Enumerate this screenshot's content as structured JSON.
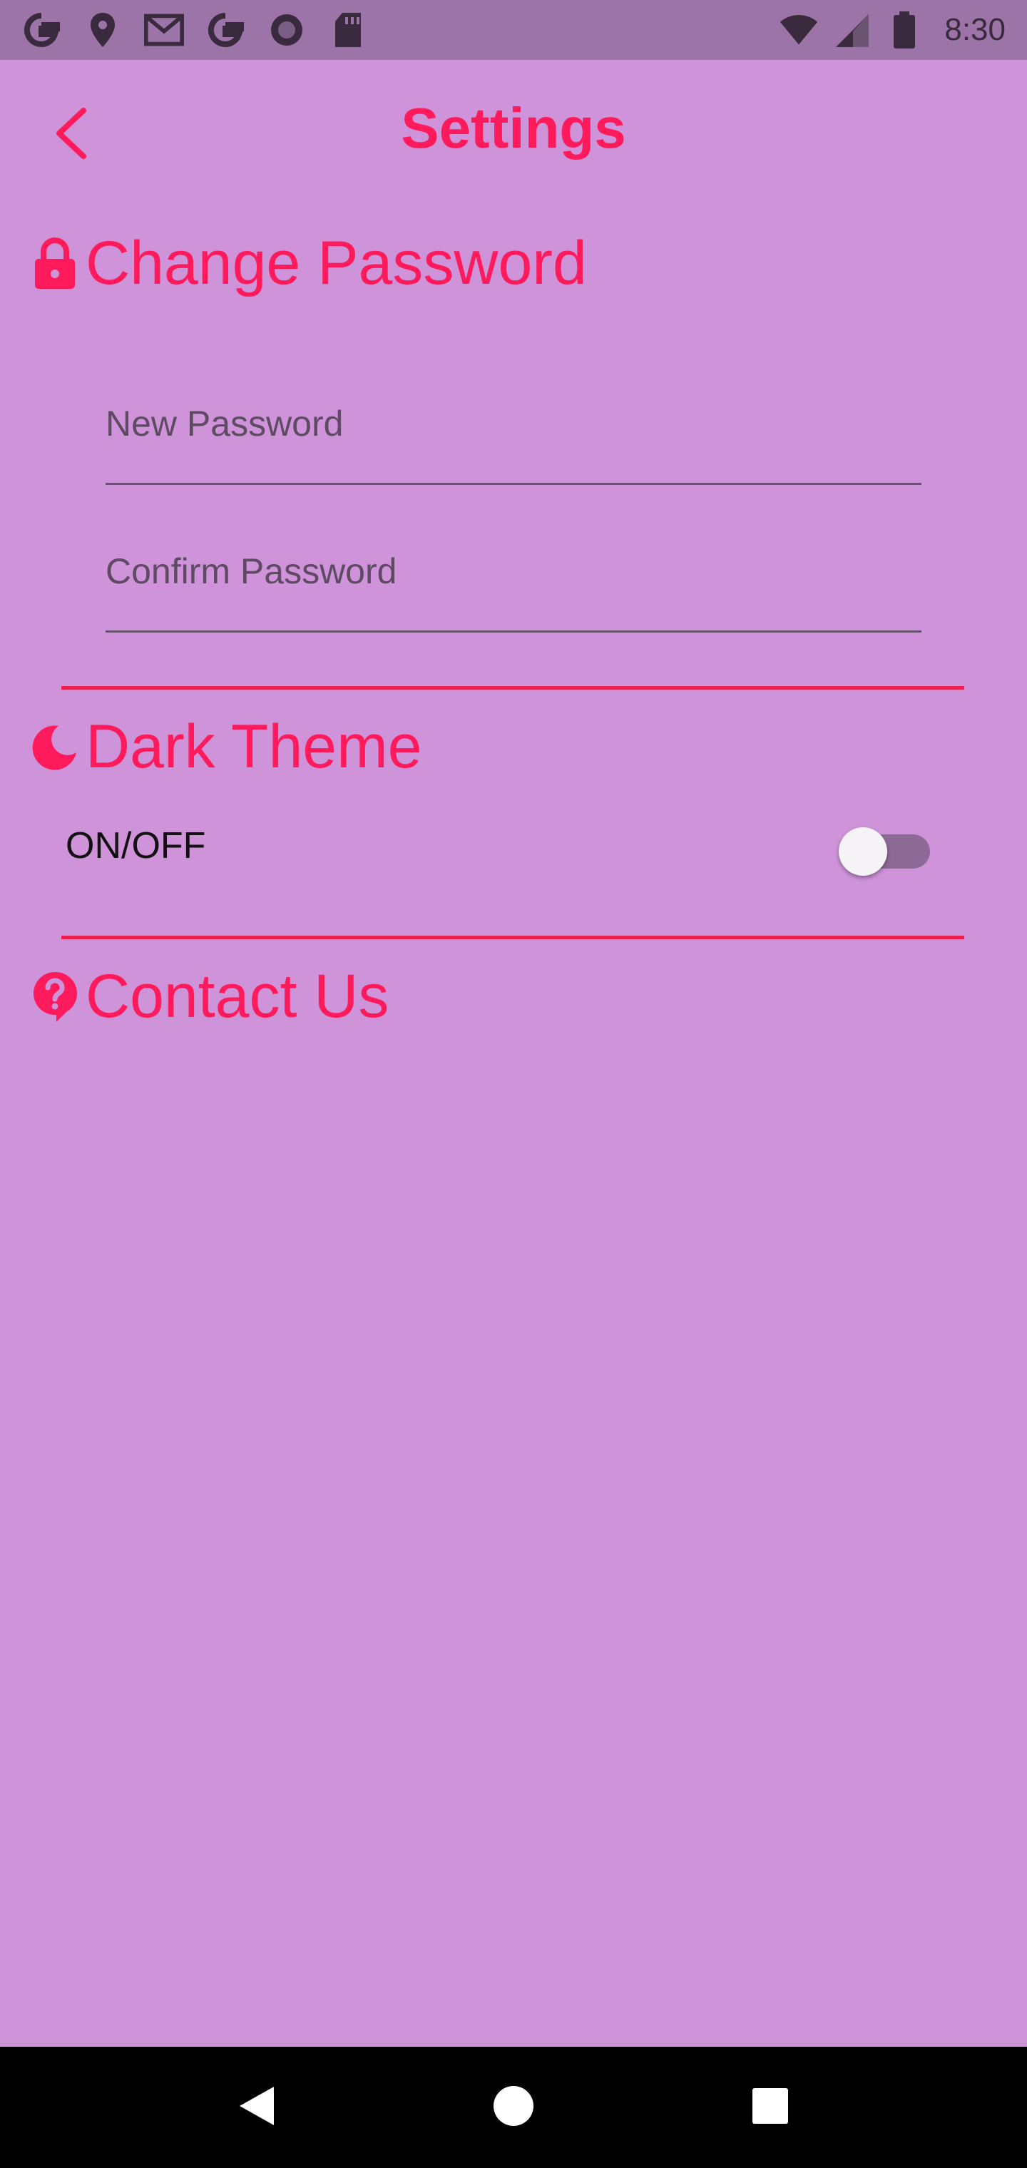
{
  "status_bar": {
    "time": "8:30",
    "left_icons": [
      "google-icon",
      "location-pin-icon",
      "gmail-icon",
      "google-icon",
      "record-icon",
      "sd-card-icon"
    ],
    "right_icons": [
      "wifi-icon",
      "signal-icon",
      "battery-icon"
    ]
  },
  "app_bar": {
    "title": "Settings",
    "back_icon": "chevron-left-icon"
  },
  "sections": {
    "change_password": {
      "label": "Change Password",
      "icon": "lock-icon",
      "new_password_placeholder": "New Password",
      "confirm_password_placeholder": "Confirm Password"
    },
    "dark_theme": {
      "label": "Dark Theme",
      "icon": "moon-icon",
      "toggle_label": "ON/OFF",
      "toggle_on": false
    },
    "contact_us": {
      "label": "Contact Us",
      "icon": "help-icon"
    }
  },
  "nav_bar": {
    "icons": [
      "back-triangle-icon",
      "home-circle-icon",
      "recents-square-icon"
    ]
  },
  "colors": {
    "background": "#ce93d8",
    "status_bar": "#9c74a8",
    "accent": "#ff1a5b",
    "divider": "#ee1f4e"
  }
}
